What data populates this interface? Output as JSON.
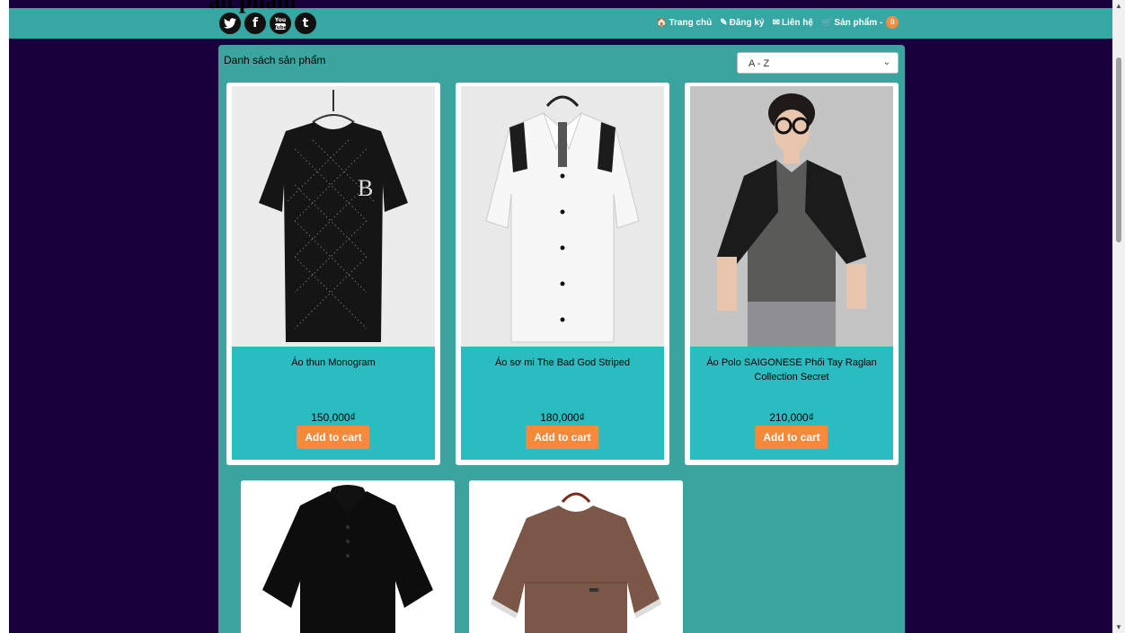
{
  "page_title_fragment": "ản phẩm",
  "topbar": {
    "social": [
      {
        "icon": "twitter-icon",
        "glyph": "🐦"
      },
      {
        "icon": "facebook-icon",
        "glyph": "f"
      },
      {
        "icon": "youtube-icon",
        "glyph": "You Tube"
      },
      {
        "icon": "tumblr-icon",
        "glyph": "t"
      }
    ],
    "nav": {
      "home": "Trang chủ",
      "register": "Đăng ký",
      "contact": "Liên hệ",
      "products": "Sản phẩm -",
      "cart_count": "0"
    }
  },
  "main": {
    "heading": "Danh sách sản phẩm",
    "sort_value": "A - Z"
  },
  "products": [
    {
      "name": "Áo thun Monogram",
      "price": "150,000₫",
      "button": "Add to cart"
    },
    {
      "name": "Áo sơ mi The Bad God Striped",
      "price": "180,000₫",
      "button": "Add to cart"
    },
    {
      "name": "Áo Polo SAIGONESE Phối Tay Raglan Collection Secret",
      "price": "210,000₫",
      "button": "Add to cart"
    }
  ],
  "colors": {
    "background": "#17003c",
    "teal": "#36a7a3",
    "card_info": "#29bcc0",
    "button": "#f8883c"
  }
}
